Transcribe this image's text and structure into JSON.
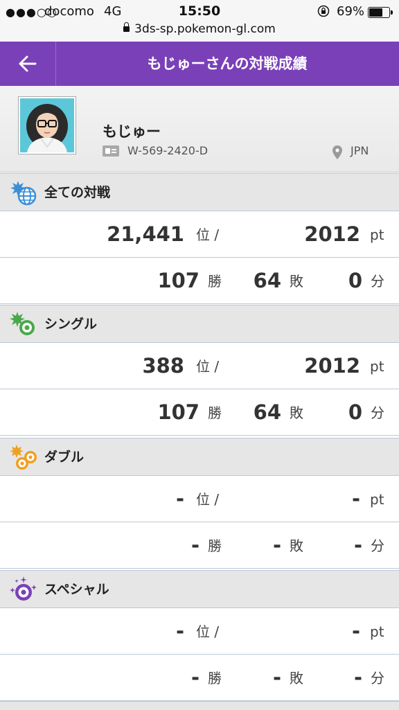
{
  "status_bar": {
    "signal": "●●●○○",
    "carrier": "docomo",
    "network": "4G",
    "time": "15:50",
    "battery_percent": "69%",
    "battery_level": 0.69,
    "url": "3ds-sp.pokemon-gl.com"
  },
  "header": {
    "back_icon": "arrow-left-icon",
    "title": "もじゅーさんの対戦成績"
  },
  "profile": {
    "name": "もじゅー",
    "player_id": "W-569-2420-D",
    "country": "JPN"
  },
  "sections": [
    {
      "label": "全ての対戦",
      "icon": "globe-battle-icon",
      "rank": "21,441",
      "rank_unit": "位 /",
      "points": "2012",
      "points_unit": "pt",
      "wins": "107",
      "wins_unit": "勝",
      "losses": "64",
      "losses_unit": "敗",
      "draws": "0",
      "draws_unit": "分"
    },
    {
      "label": "シングル",
      "icon": "single-battle-icon",
      "rank": "388",
      "rank_unit": "位 /",
      "points": "2012",
      "points_unit": "pt",
      "wins": "107",
      "wins_unit": "勝",
      "losses": "64",
      "losses_unit": "敗",
      "draws": "0",
      "draws_unit": "分"
    },
    {
      "label": "ダブル",
      "icon": "double-battle-icon",
      "rank": "-",
      "rank_unit": "位 /",
      "points": "-",
      "points_unit": "pt",
      "wins": "-",
      "wins_unit": "勝",
      "losses": "-",
      "losses_unit": "敗",
      "draws": "-",
      "draws_unit": "分"
    },
    {
      "label": "スペシャル",
      "icon": "special-battle-icon",
      "rank": "-",
      "rank_unit": "位 /",
      "points": "-",
      "points_unit": "pt",
      "wins": "-",
      "wins_unit": "勝",
      "losses": "-",
      "losses_unit": "敗",
      "draws": "-",
      "draws_unit": "分"
    }
  ],
  "colors": {
    "header_bg": "#7a40b8",
    "all_battle_icon": "#3a8fd8",
    "single_icon": "#4aa84a",
    "double_icon": "#f0a020",
    "special_icon": "#7a40b8"
  }
}
